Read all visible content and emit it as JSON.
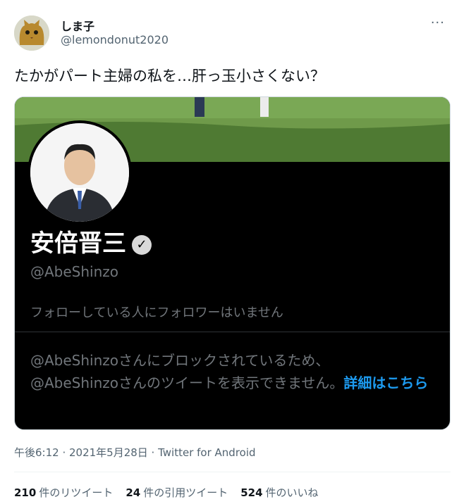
{
  "author": {
    "name": "しま子",
    "handle": "@lemondonut2020",
    "more": "···"
  },
  "tweet": {
    "text": "たかがパート主婦の私を…肝っ玉小さくない？"
  },
  "card": {
    "profile_name": "安倍晋三",
    "profile_handle": "@AbeShinzo",
    "follow_text": "フォローしている人にフォロワーはいません",
    "blocked_line1": "@AbeShinzoさんにブロックされているため、",
    "blocked_line2": "@AbeShinzoさんのツイートを表示できません。",
    "details_link": "詳細はこちら"
  },
  "meta": {
    "timestamp": "午後6:12 · 2021年5月28日 · Twitter for Android"
  },
  "stats": {
    "retweets_count": "210",
    "retweets_label": "件のリツイート",
    "quotes_count": "24",
    "quotes_label": "件の引用ツイート",
    "likes_count": "524",
    "likes_label": "件のいいね"
  }
}
